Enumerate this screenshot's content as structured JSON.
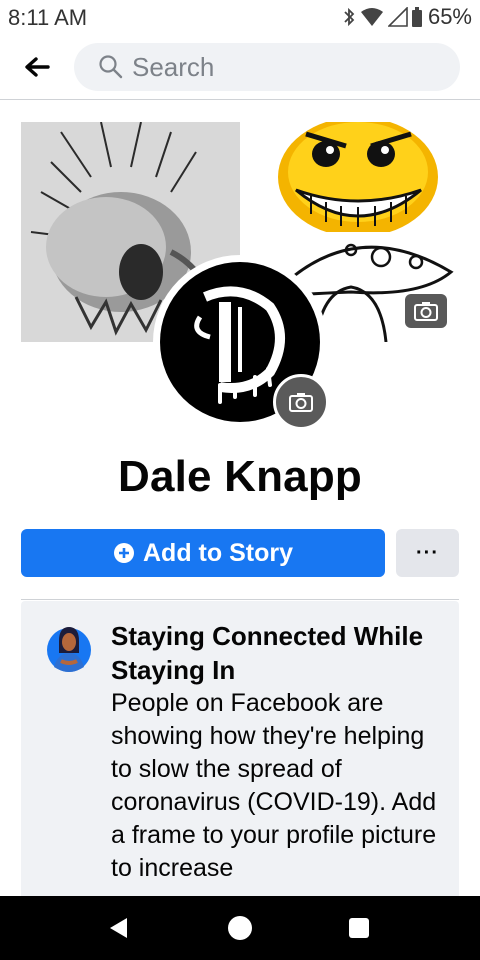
{
  "status_bar": {
    "time": "8:11 AM",
    "battery": "65%",
    "icons": [
      "bluetooth-icon",
      "wifi-icon",
      "signal-icon",
      "battery-icon"
    ]
  },
  "top_bar": {
    "back_icon": "back-arrow-icon",
    "search_placeholder": "Search"
  },
  "profile": {
    "name": "Dale Knapp",
    "cover_camera_icon": "camera-icon",
    "avatar_camera_icon": "camera-icon"
  },
  "actions": {
    "add_story_label": "Add to Story",
    "more_label": "···"
  },
  "card": {
    "title": "Staying Connected While Staying In",
    "body": "People on Facebook are showing how they're helping to slow the spread of coronavirus (COVID-19). Add a frame to your profile picture to increase"
  },
  "nav": {
    "items": [
      "back-triangle-icon",
      "home-circle-icon",
      "recents-square-icon"
    ]
  },
  "colors": {
    "primary": "#1877f2",
    "secondary_button": "#e4e6eb",
    "card_bg": "#f0f2f5",
    "nav_bar": "#000000"
  }
}
